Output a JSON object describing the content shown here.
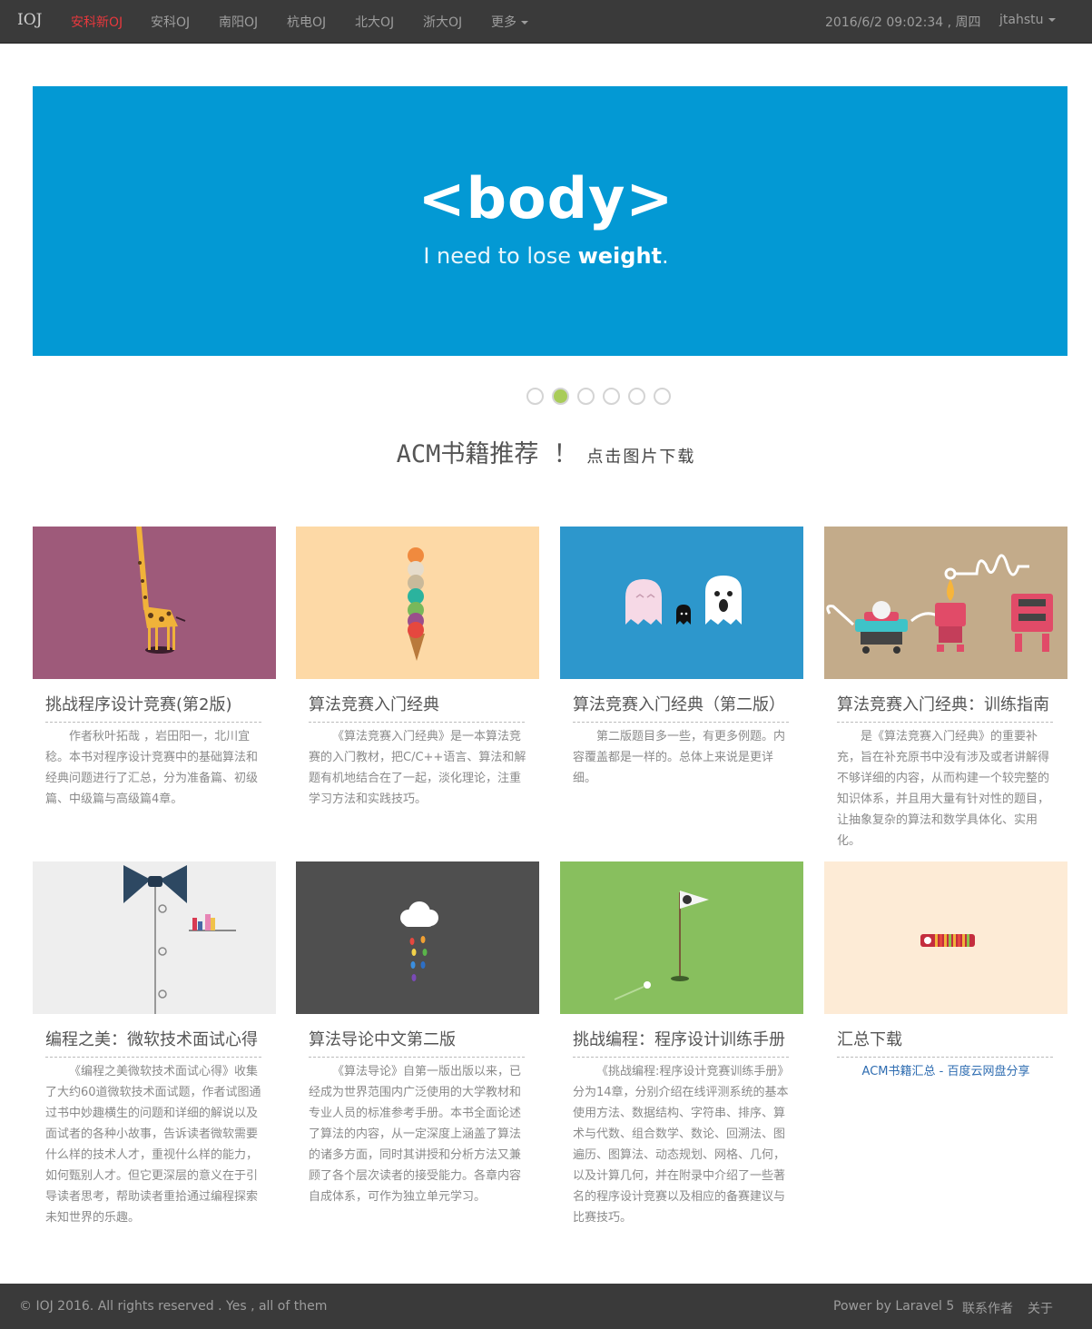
{
  "navbar": {
    "brand": "IOJ",
    "items": [
      {
        "label": "安科新OJ",
        "active": true
      },
      {
        "label": "安科OJ"
      },
      {
        "label": "南阳OJ"
      },
      {
        "label": "杭电OJ"
      },
      {
        "label": "北大OJ"
      },
      {
        "label": "浙大OJ"
      },
      {
        "label": "更多"
      }
    ],
    "datetime": "2016/6/2 09:02:34 , 周四",
    "user": "jtahstu"
  },
  "banner": {
    "title": "<body>",
    "subtitle_prefix": "I need to lose ",
    "subtitle_bold": "weight",
    "subtitle_suffix": ".",
    "background": "#0399d4"
  },
  "carousel": {
    "count": 6,
    "active_index": 1
  },
  "section": {
    "heading": "ACM书籍推荐 ！",
    "subheading": "点击图片下载"
  },
  "books": [
    {
      "title": "挑战程序设计竞赛(第2版)",
      "desc": "作者秋叶拓哉 ，岩田阳一，北川宜稔。本书对程序设计竞赛中的基础算法和经典问题进行了汇总，分为准备篇、初级篇、中级篇与高级篇4章。",
      "bg": "#9e5a7a"
    },
    {
      "title": "算法竞赛入门经典",
      "desc": "《算法竞赛入门经典》是一本算法竞赛的入门教材，把C/C++语言、算法和解题有机地结合在了一起，淡化理论，注重学习方法和实践技巧。",
      "bg": "#fdd9a6"
    },
    {
      "title": "算法竞赛入门经典（第二版）",
      "desc": "第二版题目多一些，有更多例题。内容覆盖都是一样的。总体上来说是更详细。",
      "bg": "#2d97cc"
    },
    {
      "title": "算法竞赛入门经典：训练指南",
      "desc": "是《算法竞赛入门经典》的重要补充，旨在补充原书中没有涉及或者讲解得不够详细的内容，从而构建一个较完整的知识体系，并且用大量有针对性的题目，让抽象复杂的算法和数学具体化、实用化。",
      "bg": "#c3ab8a"
    },
    {
      "title": "编程之美：微软技术面试心得",
      "desc": "《编程之美微软技术面试心得》收集了大约60道微软技术面试题，作者试图通过书中妙趣横生的问题和详细的解说以及面试者的各种小故事，告诉读者微软需要什么样的技术人才，重视什么样的能力，如何甄别人才。但它更深层的意义在于引导读者思考，帮助读者重拾通过编程探索未知世界的乐趣。",
      "bg": "#eeeeee"
    },
    {
      "title": "算法导论中文第二版",
      "desc": "《算法导论》自第一版出版以来，已经成为世界范围内广泛使用的大学教材和专业人员的标准参考手册。本书全面论述了算法的内容，从一定深度上涵盖了算法的诸多方面，同时其讲授和分析方法又兼顾了各个层次读者的接受能力。各章内容自成体系，可作为独立单元学习。",
      "bg": "#4f4f4f"
    },
    {
      "title": "挑战编程：程序设计训练手册",
      "desc": "《挑战编程:程序设计竞赛训练手册》分为14章，分别介绍在线评测系统的基本使用方法、数据结构、字符串、排序、算术与代数、组合数学、数论、回溯法、图遍历、图算法、动态规划、网格、几何，以及计算几何，并在附录中介绍了一些著名的程序设计竞赛以及相应的备赛建议与比赛技巧。",
      "bg": "#88bf5e"
    },
    {
      "title": "汇总下载",
      "link": "ACM书籍汇总 - 百度云网盘分享",
      "bg": "#fdebd6"
    }
  ],
  "footer": {
    "copyright": "© IOJ 2016. All rights reserved . Yes , all of them",
    "power": "Power by Laravel 5",
    "contact": "联系作者",
    "about": "关于"
  }
}
